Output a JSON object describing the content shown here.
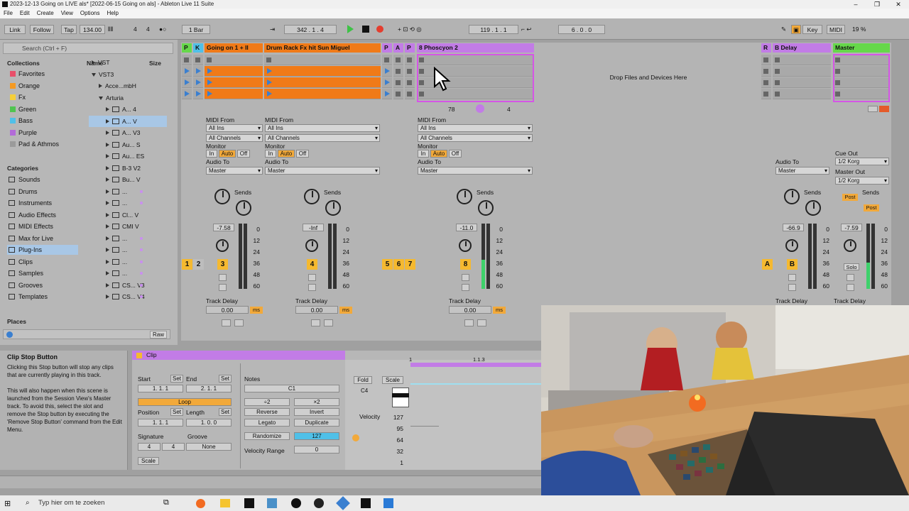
{
  "window": {
    "title": "2023-12-13 Going on LIVE als* [2022-06-15 Going on als] - Ableton Live 11 Suite"
  },
  "menu": [
    "File",
    "Edit",
    "Create",
    "View",
    "Options",
    "Help"
  ],
  "toolbar": {
    "link": "Link",
    "follow": "Follow",
    "tap": "Tap",
    "tempo": "134.00",
    "signature_num": "4",
    "signature_den": "4",
    "quantize": "1 Bar",
    "position": "342 .  1 .  4",
    "loop_start": "119 .  1 .  1",
    "loop_length": "6 .  0 .  0",
    "key": "Key",
    "midi": "MIDI",
    "cpu": "19 %"
  },
  "browser": {
    "search_placeholder": "Search (Ctrl + F)",
    "collections_label": "Collections",
    "collections": [
      {
        "label": "Favorites",
        "color": "#e84f6a"
      },
      {
        "label": "Orange",
        "color": "#f59a23"
      },
      {
        "label": "Fx",
        "color": "#f5cf3a"
      },
      {
        "label": "Green",
        "color": "#50c450"
      },
      {
        "label": "Bass",
        "color": "#4fc0e8"
      },
      {
        "label": "Purple",
        "color": "#b26bd8"
      },
      {
        "label": "Pad & Athmos",
        "color": "#9a9a9a"
      }
    ],
    "categories_label": "Categories",
    "categories": [
      "Sounds",
      "Drums",
      "Instruments",
      "Audio Effects",
      "MIDI Effects",
      "Max for Live",
      "Plug-Ins",
      "Clips",
      "Samples",
      "Grooves",
      "Templates"
    ],
    "places_label": "Places",
    "name_header": "Name",
    "size_header": "Size",
    "files": [
      "VST",
      "VST3",
      "Acce...mbH",
      "Arturia",
      "A... 4",
      "A... V",
      "A... V3",
      "Au... S",
      "Au... ES",
      "B-3 V2",
      "Bu... V",
      "...",
      "...",
      "Cl... V",
      "CMI V",
      "...",
      "...",
      "...",
      "...",
      "CS... V3",
      "CS... V4"
    ],
    "raw_label": "Raw"
  },
  "tracks": [
    {
      "name": "Going on 1 + II",
      "color": "#f07a18"
    },
    {
      "name": "Drum Rack Fx hit Sun Miguel",
      "color": "#f07a18"
    },
    {
      "name": "8 Phoscyon 2",
      "color": "#c27ce6"
    },
    {
      "name": "B Delay",
      "color": "#c27ce6"
    },
    {
      "name": "Master",
      "color": "#66d84a"
    }
  ],
  "small_tracks": [
    "P",
    "K",
    "P",
    "A",
    "P",
    "R"
  ],
  "drop_text": "Drop Files and Devices Here",
  "mixer": {
    "midi_from": "MIDI From",
    "all_ins": "All Ins",
    "all_channels": "All Channels",
    "monitor": "Monitor",
    "mon_in": "In",
    "mon_auto": "Auto",
    "mon_off": "Off",
    "audio_to": "Audio To",
    "master": "Master",
    "sends": "Sends",
    "cue_out": "Cue Out",
    "master_out": "Master Out",
    "korg": "1/2 Korg",
    "post": "Post",
    "solo": "Solo",
    "track_delay": "Track Delay",
    "delay_value": "0.00",
    "ms": "ms",
    "vol1": "-7.58",
    "vol2": "-Inf",
    "vol3": "-11.0",
    "vol4": "-66.9",
    "vol5": "-7.59",
    "track_numbers": [
      "1",
      "2",
      "3",
      "4",
      "5",
      "6",
      "7",
      "8",
      "A",
      "B"
    ],
    "db_scale": [
      "0",
      "12",
      "24",
      "36",
      "48",
      "60"
    ],
    "stop_row_num1": "78",
    "stop_row_num2": "4"
  },
  "info_view": {
    "title": "Clip Stop Button",
    "body": "Clicking this Stop button will stop any clips that are currently playing in this track.\n\nThis will also happen when this scene is launched from the Session View's Master track. To avoid this, select the slot and remove the Stop button by executing the 'Remove Stop Button' command from the Edit Menu."
  },
  "clip_view": {
    "clip_label": "Clip",
    "notes_label": "Notes",
    "start": "Start",
    "end": "End",
    "set": "Set",
    "start_val": "1.  1.  1",
    "end_val": "2.  1.  1",
    "loop": "Loop",
    "position": "Position",
    "length": "Length",
    "pos_val": "1.  1.  1",
    "len_val": "1.  0.  0",
    "signature": "Signature",
    "groove": "Groove",
    "sig_num": "4",
    "sig_den": "4",
    "groove_val": "None",
    "note_range": "C1",
    "div2": "÷2",
    "x2": "×2",
    "reverse": "Reverse",
    "invert": "Invert",
    "legato": "Legato",
    "duplicate": "Duplicate",
    "randomize": "Randomize",
    "rand_val": "127",
    "velocity_range": "Velocity Range",
    "vel_range_val": "0",
    "scale": "Scale",
    "fold": "Fold",
    "scale_btn": "Scale",
    "key_c4": "C4",
    "velocity": "Velocity",
    "vel_scale": [
      "127",
      "95",
      "64",
      "32",
      "1"
    ],
    "ruler1": "1",
    "ruler2": "1.1.3"
  },
  "taskbar": {
    "search_placeholder": "Typ hier om te zoeken"
  }
}
